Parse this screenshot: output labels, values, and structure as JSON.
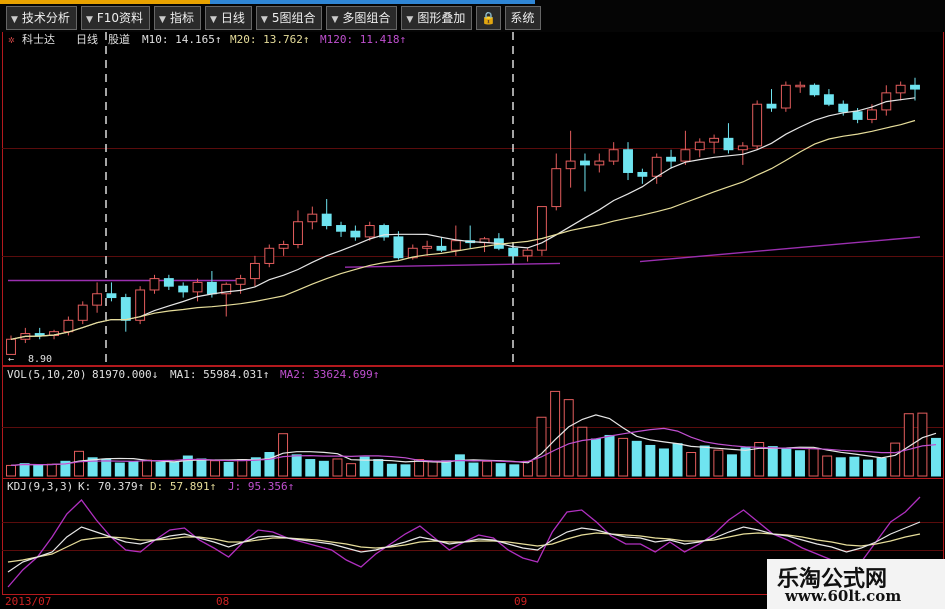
{
  "toolbar": {
    "tabs": [
      "技术分析",
      "F10资料",
      "指标",
      "日线",
      "5图组合",
      "多图组合",
      "图形叠加"
    ],
    "lock_icon": "lock-icon",
    "last_tab": "系统"
  },
  "chart_data": {
    "type": "candlestick",
    "stock": {
      "name": "科士达",
      "period": "日线",
      "extra": "股道"
    },
    "price_header": {
      "ma10_label": "M10: 14.165↑",
      "ma20_label": "M20: 13.762↑",
      "ma120_label": "M120: 11.418↑"
    },
    "price_low_marker": "8.90",
    "vol_header": {
      "name_label": "VOL(5,10,20)",
      "value_label": "81970.000↓",
      "ma1_label": "MA1: 55984.031↑",
      "ma2_label": "MA2: 33624.699↑"
    },
    "kdj_header": {
      "name_label": "KDJ(9,3,3)",
      "k_label": "K: 70.379↑",
      "d_label": "D: 57.891↑",
      "j_label": "J: 95.356↑"
    },
    "date_labels": [
      "2013/07",
      "08",
      "09"
    ],
    "ohlc": [
      [
        8.9,
        9.4,
        8.9,
        9.3
      ],
      [
        9.3,
        9.6,
        9.2,
        9.45
      ],
      [
        9.45,
        9.6,
        9.3,
        9.4
      ],
      [
        9.4,
        9.55,
        9.3,
        9.5
      ],
      [
        9.5,
        9.9,
        9.4,
        9.8
      ],
      [
        9.8,
        10.3,
        9.7,
        10.2
      ],
      [
        10.2,
        10.8,
        10.0,
        10.5
      ],
      [
        10.5,
        10.8,
        10.3,
        10.4
      ],
      [
        10.4,
        10.5,
        9.5,
        9.8
      ],
      [
        9.8,
        10.7,
        9.7,
        10.6
      ],
      [
        10.6,
        11.0,
        10.5,
        10.9
      ],
      [
        10.9,
        11.0,
        10.6,
        10.7
      ],
      [
        10.7,
        10.8,
        10.4,
        10.55
      ],
      [
        10.55,
        10.9,
        10.3,
        10.8
      ],
      [
        10.8,
        11.1,
        10.4,
        10.5
      ],
      [
        10.5,
        10.8,
        9.9,
        10.75
      ],
      [
        10.75,
        11.0,
        10.5,
        10.9
      ],
      [
        10.9,
        11.5,
        10.7,
        11.3
      ],
      [
        11.3,
        11.8,
        11.2,
        11.7
      ],
      [
        11.7,
        11.9,
        11.5,
        11.8
      ],
      [
        11.8,
        12.7,
        11.7,
        12.4
      ],
      [
        12.4,
        12.8,
        12.2,
        12.6
      ],
      [
        12.6,
        13.0,
        12.2,
        12.3
      ],
      [
        12.3,
        12.4,
        12.0,
        12.15
      ],
      [
        12.15,
        12.3,
        11.9,
        12.0
      ],
      [
        12.0,
        12.4,
        11.9,
        12.3
      ],
      [
        12.3,
        12.35,
        11.9,
        12.0
      ],
      [
        12.0,
        12.15,
        11.4,
        11.45
      ],
      [
        11.45,
        11.8,
        11.4,
        11.7
      ],
      [
        11.7,
        11.9,
        11.5,
        11.75
      ],
      [
        11.75,
        12.0,
        11.6,
        11.65
      ],
      [
        11.65,
        12.3,
        11.5,
        11.9
      ],
      [
        11.9,
        12.3,
        11.7,
        11.85
      ],
      [
        11.85,
        12.0,
        11.6,
        11.95
      ],
      [
        11.95,
        12.1,
        11.65,
        11.7
      ],
      [
        11.7,
        11.75,
        11.4,
        11.5
      ],
      [
        11.5,
        11.7,
        11.35,
        11.65
      ],
      [
        11.65,
        12.2,
        11.5,
        12.8
      ],
      [
        12.8,
        14.2,
        12.7,
        13.8
      ],
      [
        13.8,
        14.8,
        13.3,
        14.0
      ],
      [
        14.0,
        14.2,
        13.2,
        13.9
      ],
      [
        13.9,
        14.2,
        13.7,
        14.0
      ],
      [
        14.0,
        14.5,
        13.9,
        14.3
      ],
      [
        14.3,
        14.5,
        13.5,
        13.7
      ],
      [
        13.7,
        13.8,
        13.4,
        13.6
      ],
      [
        13.6,
        14.2,
        13.4,
        14.1
      ],
      [
        14.1,
        14.3,
        13.8,
        14.0
      ],
      [
        14.0,
        14.8,
        13.9,
        14.3
      ],
      [
        14.3,
        14.6,
        14.1,
        14.5
      ],
      [
        14.5,
        14.7,
        14.2,
        14.6
      ],
      [
        14.6,
        15.0,
        14.2,
        14.3
      ],
      [
        14.3,
        14.5,
        13.9,
        14.4
      ],
      [
        14.4,
        15.6,
        14.3,
        15.5
      ],
      [
        15.5,
        15.9,
        15.3,
        15.4
      ],
      [
        15.4,
        16.1,
        15.3,
        16.0
      ],
      [
        16.0,
        16.1,
        15.8,
        16.0
      ],
      [
        16.0,
        16.05,
        15.7,
        15.75
      ],
      [
        15.75,
        15.9,
        15.45,
        15.5
      ],
      [
        15.5,
        15.6,
        15.2,
        15.3
      ],
      [
        15.3,
        15.4,
        15.0,
        15.1
      ],
      [
        15.1,
        15.5,
        15.0,
        15.35
      ],
      [
        15.35,
        16.0,
        15.2,
        15.8
      ],
      [
        15.8,
        16.1,
        15.6,
        16.0
      ],
      [
        16.0,
        16.2,
        15.6,
        15.9
      ]
    ],
    "volume": [
      9000,
      10500,
      9500,
      10000,
      12500,
      21000,
      15500,
      14500,
      11000,
      12000,
      13500,
      11500,
      12000,
      17000,
      14500,
      13000,
      11500,
      14000,
      15500,
      20000,
      36000,
      18000,
      14000,
      12500,
      14500,
      10500,
      16000,
      14000,
      10000,
      9500,
      14000,
      12500,
      13000,
      18000,
      11000,
      12500,
      10500,
      9500,
      12500,
      50000,
      72000,
      65000,
      41500,
      31500,
      34500,
      32000,
      29500,
      26000,
      23000,
      27500,
      20000,
      25500,
      22000,
      18000,
      24000,
      28500,
      25000,
      23500,
      21500,
      23500,
      17000,
      15500,
      16000,
      13500,
      15000,
      28000,
      53000,
      53500,
      32000
    ],
    "kdj_k": [
      20,
      30,
      35,
      40,
      55,
      65,
      60,
      55,
      50,
      48,
      52,
      56,
      58,
      54,
      50,
      45,
      50,
      55,
      56,
      54,
      52,
      50,
      48,
      44,
      40,
      42,
      46,
      50,
      55,
      52,
      48,
      50,
      53,
      52,
      48,
      44,
      42,
      52,
      60,
      64,
      62,
      58,
      55,
      54,
      50,
      52,
      48,
      50,
      54,
      60,
      65,
      62,
      58,
      56,
      52,
      48,
      45,
      40,
      44,
      50,
      58,
      64,
      70
    ],
    "kdj_d": [
      30,
      32,
      35,
      38,
      45,
      52,
      54,
      55,
      54,
      52,
      52,
      53,
      55,
      55,
      53,
      50,
      50,
      52,
      54,
      54,
      53,
      52,
      50,
      48,
      45,
      44,
      45,
      47,
      50,
      51,
      50,
      50,
      51,
      51,
      50,
      48,
      46,
      48,
      53,
      57,
      59,
      58,
      57,
      56,
      54,
      53,
      51,
      51,
      52,
      55,
      58,
      59,
      58,
      57,
      55,
      52,
      50,
      47,
      46,
      48,
      51,
      55,
      58
    ],
    "kdj_j": [
      5,
      22,
      35,
      55,
      78,
      92,
      72,
      55,
      42,
      40,
      52,
      62,
      64,
      52,
      44,
      35,
      50,
      62,
      60,
      54,
      50,
      46,
      42,
      32,
      25,
      38,
      48,
      58,
      66,
      54,
      42,
      50,
      57,
      54,
      42,
      34,
      30,
      60,
      80,
      82,
      70,
      56,
      48,
      48,
      40,
      50,
      40,
      48,
      58,
      72,
      82,
      70,
      58,
      52,
      44,
      38,
      32,
      22,
      30,
      50,
      70,
      80,
      95
    ]
  },
  "watermark": {
    "cn": "乐淘公式网",
    "url": "www.60lt.com"
  }
}
